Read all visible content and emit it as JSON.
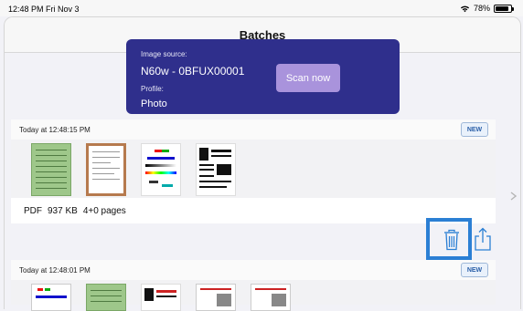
{
  "status_bar": {
    "time_date": "12:48 PM  Fri Nov 3",
    "battery": "78%",
    "battery_level": 0.78,
    "icons": [
      "wifi-icon",
      "battery-icon"
    ]
  },
  "nav": {
    "title": "Batches"
  },
  "scan_card": {
    "source_label": "Image source:",
    "source_value": "N60w - 0BFUX00001",
    "profile_label": "Profile:",
    "profile_value": "Photo",
    "scan_button": "Scan now",
    "card_color": "#2f2f8c",
    "button_color": "#a993dc"
  },
  "batches": [
    {
      "timestamp": "Today at 12:48:15 PM",
      "badge": "NEW",
      "format": "PDF",
      "size": "937 KB",
      "pages": "4+0 pages"
    },
    {
      "timestamp": "Today at 12:48:01 PM",
      "badge": "NEW"
    }
  ],
  "colors": {
    "highlight": "#2b7fd4",
    "accent": "#2a5fa8"
  }
}
